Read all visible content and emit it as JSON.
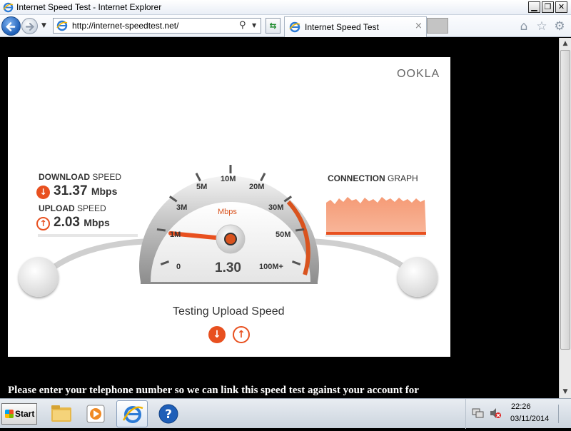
{
  "window": {
    "title": "Internet Speed Test - Internet Explorer",
    "minimize_label": "▁",
    "restore_label": "❐",
    "close_label": "✕"
  },
  "navbar": {
    "url": "http://internet-speedtest.net/",
    "search_icon": "search-icon",
    "tab_title": "Internet Speed Test",
    "tab_close": "×"
  },
  "speedtest": {
    "brand": "OOKLA",
    "download": {
      "label_bold": "DOWNLOAD",
      "label_rest": " SPEED",
      "value": "31.37",
      "unit": "Mbps"
    },
    "upload": {
      "label_bold": "UPLOAD",
      "label_rest": " SPEED",
      "value": "2.03",
      "unit": "Mbps"
    },
    "gauge": {
      "unit": "Mbps",
      "reading": "1.30",
      "ticks": [
        "0",
        "1M",
        "3M",
        "5M",
        "10M",
        "20M",
        "30M",
        "50M",
        "100M+"
      ]
    },
    "connection_graph": {
      "label_bold": "CONNECTION",
      "label_rest": " GRAPH"
    },
    "status": "Testing Upload Speed"
  },
  "page_text": "Please enter your telephone number so we can link this speed test against your account for",
  "taskbar": {
    "start_label": "Start",
    "time": "22:26",
    "date": "03/11/2014"
  },
  "colors": {
    "accent": "#e8501f",
    "graph_fill": "#f7a07d"
  }
}
